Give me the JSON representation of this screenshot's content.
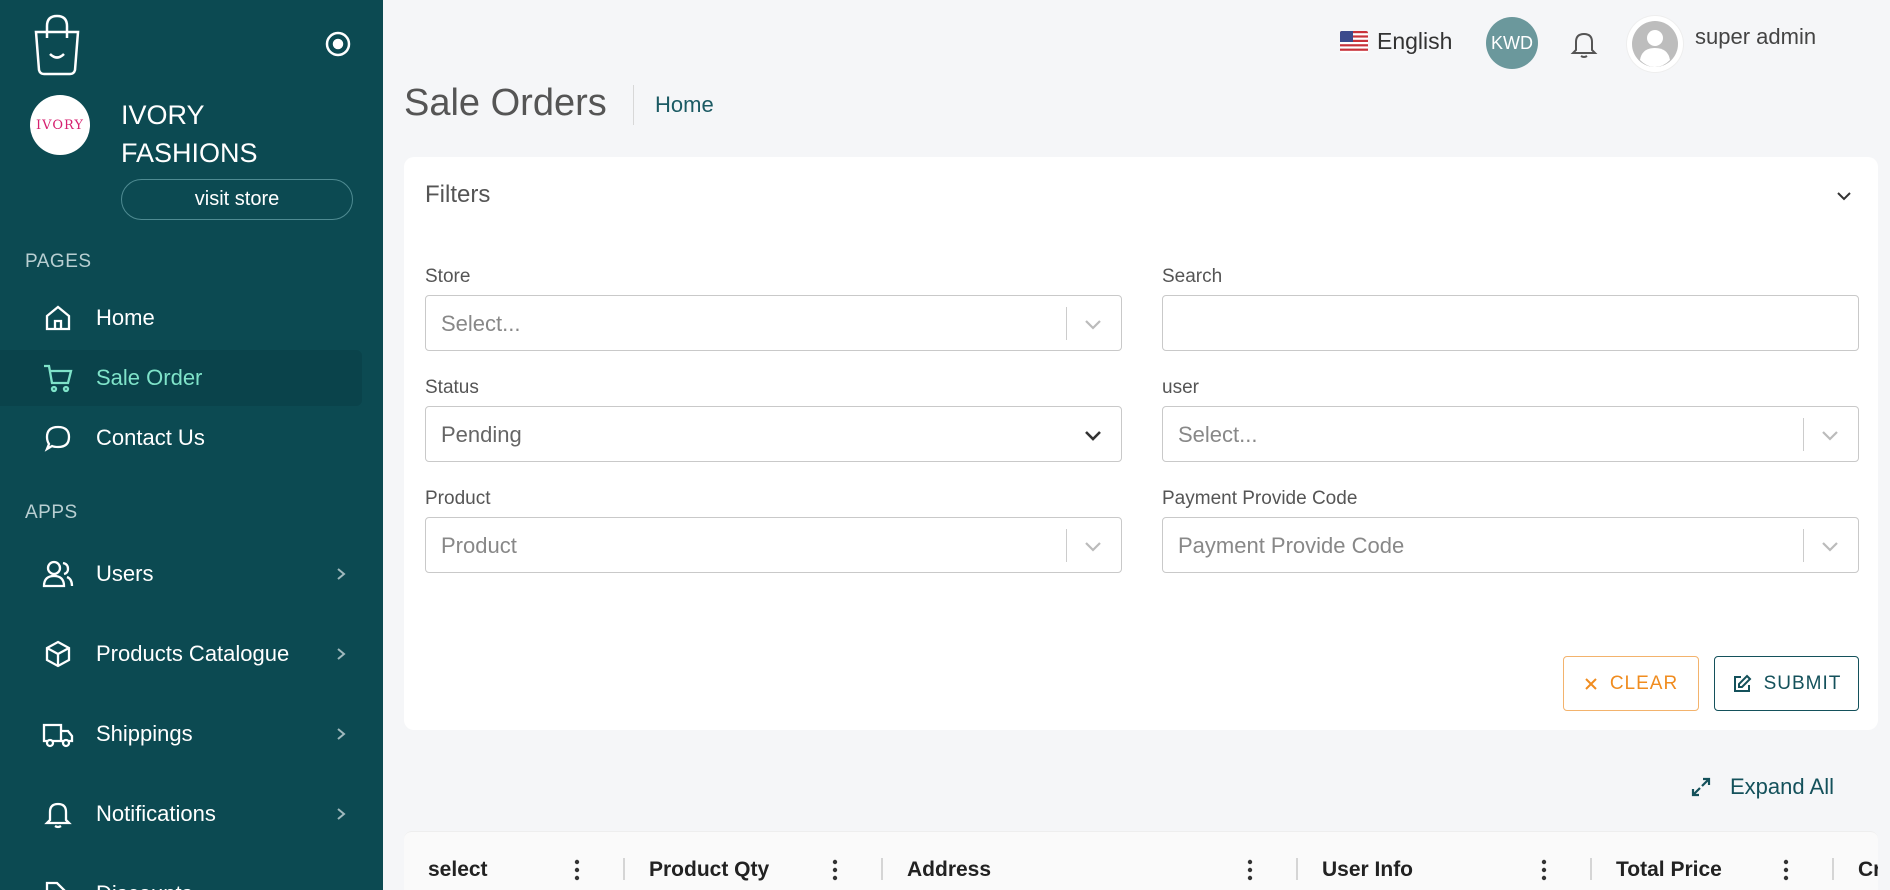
{
  "sidebar": {
    "brand_logo_text": "IVORY",
    "brand_name": "IVORY FASHIONS",
    "visit_store_label": "visit store",
    "sections": {
      "pages": "PAGES",
      "apps": "APPS"
    },
    "pages_items": [
      {
        "label": "Home",
        "icon": "home-icon"
      },
      {
        "label": "Sale Order",
        "icon": "cart-icon",
        "active": true
      },
      {
        "label": "Contact Us",
        "icon": "chat-icon"
      }
    ],
    "apps_items": [
      {
        "label": "Users",
        "icon": "users-icon"
      },
      {
        "label": "Products Catalogue",
        "icon": "box-icon"
      },
      {
        "label": "Shippings",
        "icon": "truck-icon"
      },
      {
        "label": "Notifications",
        "icon": "bell-icon"
      },
      {
        "label": "Discounts",
        "icon": "tag-icon"
      }
    ]
  },
  "header": {
    "language": "English",
    "currency": "KWD",
    "user_name": "super admin"
  },
  "page": {
    "title": "Sale Orders",
    "breadcrumb": "Home"
  },
  "filters": {
    "title": "Filters",
    "store": {
      "label": "Store",
      "placeholder": "Select..."
    },
    "search": {
      "label": "Search",
      "value": ""
    },
    "status": {
      "label": "Status",
      "value": "Pending"
    },
    "user": {
      "label": "user",
      "placeholder": "Select..."
    },
    "product": {
      "label": "Product",
      "placeholder": "Product"
    },
    "payment": {
      "label": "Payment Provide Code",
      "placeholder": "Payment Provide Code"
    },
    "clear_label": "CLEAR",
    "submit_label": "SUBMIT"
  },
  "expand_all_label": "Expand All",
  "table": {
    "columns": [
      "select",
      "Product Qty",
      "Address",
      "User Info",
      "Total Price",
      "Cr"
    ]
  },
  "colors": {
    "sidebar_bg": "#0c4a52",
    "active_text": "#7fe3c9",
    "accent": "#14515b",
    "clear_orange": "#f08c1f"
  }
}
